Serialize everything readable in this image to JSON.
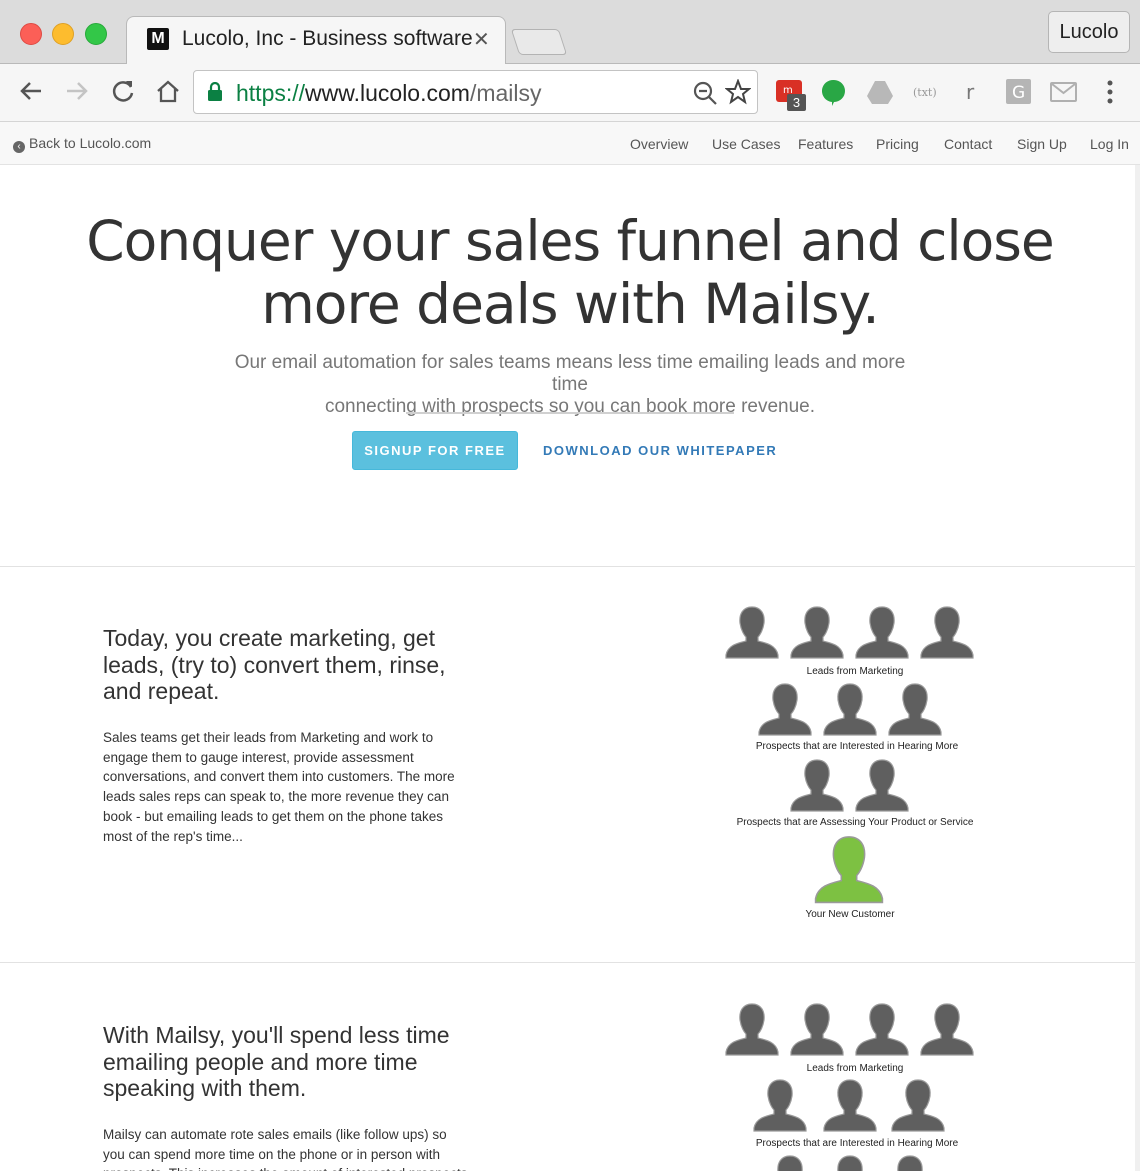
{
  "browser": {
    "tab_title": "Lucolo, Inc - Business software",
    "profile_name": "Lucolo",
    "url": {
      "protocol": "https://",
      "host": "www.lucolo.com",
      "path": "/mailsy"
    },
    "extension_badge": "3",
    "icons": [
      "back-arrow-icon",
      "forward-arrow-icon",
      "reload-icon",
      "home-icon",
      "lock-icon",
      "zoom-icon",
      "star-icon",
      "menu-dots-icon"
    ]
  },
  "subnav": {
    "back_link": "Back to Lucolo.com",
    "menu": [
      "Overview",
      "Use Cases",
      "Features",
      "Pricing",
      "Contact",
      "Sign Up",
      "Log In"
    ]
  },
  "hero": {
    "title_line1": "Conquer your sales funnel and close",
    "title_line2": "more deals with Mailsy.",
    "subtitle_line1": "Our email automation for sales teams means less time emailing leads and more time",
    "subtitle_line2": "connecting with prospects so you can book more revenue.",
    "signup_label": "SIGNUP FOR FREE",
    "whitepaper_label": "DOWNLOAD OUR WHITEPAPER",
    "accent_color": "#5bc0de",
    "link_color": "#337ab7"
  },
  "section1": {
    "title": "Today, you create marketing, get leads, (try to) convert them, rinse, and repeat.",
    "body": "Sales teams get their leads from Marketing and work to engage them to gauge interest, provide assessment conversations, and convert them into customers. The more leads sales reps can speak to, the more revenue they can book - but emailing leads to get them on the phone takes most of the rep's time...",
    "funnel_labels": [
      "Leads from Marketing",
      "Prospects that are Interested in Hearing More",
      "Prospects that are Assessing Your Product or Service",
      "Your New Customer"
    ],
    "person_color": "#5f5f5f",
    "customer_color": "#7dc142"
  },
  "section2": {
    "title": "With Mailsy, you'll spend less time emailing people and more time speaking with them.",
    "body": "Mailsy can automate rote sales emails (like follow ups) so you can spend more time on the phone or in person with prospects. This increases the amount of interested prospects you can speak with and likely increases your revenue.",
    "funnel_labels": [
      "Leads from Marketing",
      "Prospects that are Interested in Hearing More"
    ]
  }
}
